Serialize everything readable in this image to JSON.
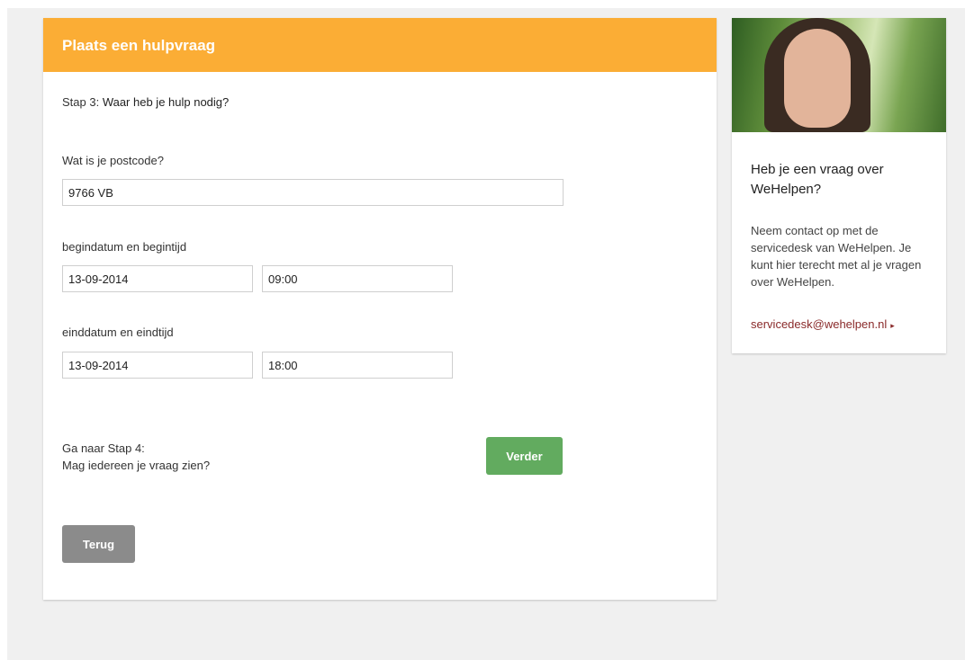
{
  "form": {
    "title": "Plaats een hulpvraag",
    "step_prefix": "Stap 3: ",
    "step_title": "Waar heb je hulp nodig?",
    "postcode": {
      "label": "Wat is je postcode?",
      "value": "9766 VB"
    },
    "start": {
      "label": "begindatum en begintijd",
      "date": "13-09-2014",
      "time": "09:00"
    },
    "end": {
      "label": "einddatum en eindtijd",
      "date": "13-09-2014",
      "time": "18:00"
    },
    "next_line1": "Ga naar Stap 4:",
    "next_line2": "Mag iedereen je vraag zien?",
    "next_button": "Verder",
    "back_button": "Terug"
  },
  "sidebar": {
    "title": "Heb je een vraag over WeHelpen?",
    "text": "Neem contact op met de servicedesk van WeHelpen. Je kunt hier terecht met al je vragen over WeHelpen.",
    "link": "servicedesk@wehelpen.nl",
    "link_arrow": "▸"
  },
  "colors": {
    "header": "#fbad35",
    "next_button": "#62ab5f",
    "back_button": "#8b8b8b",
    "link": "#8a2a2a"
  }
}
